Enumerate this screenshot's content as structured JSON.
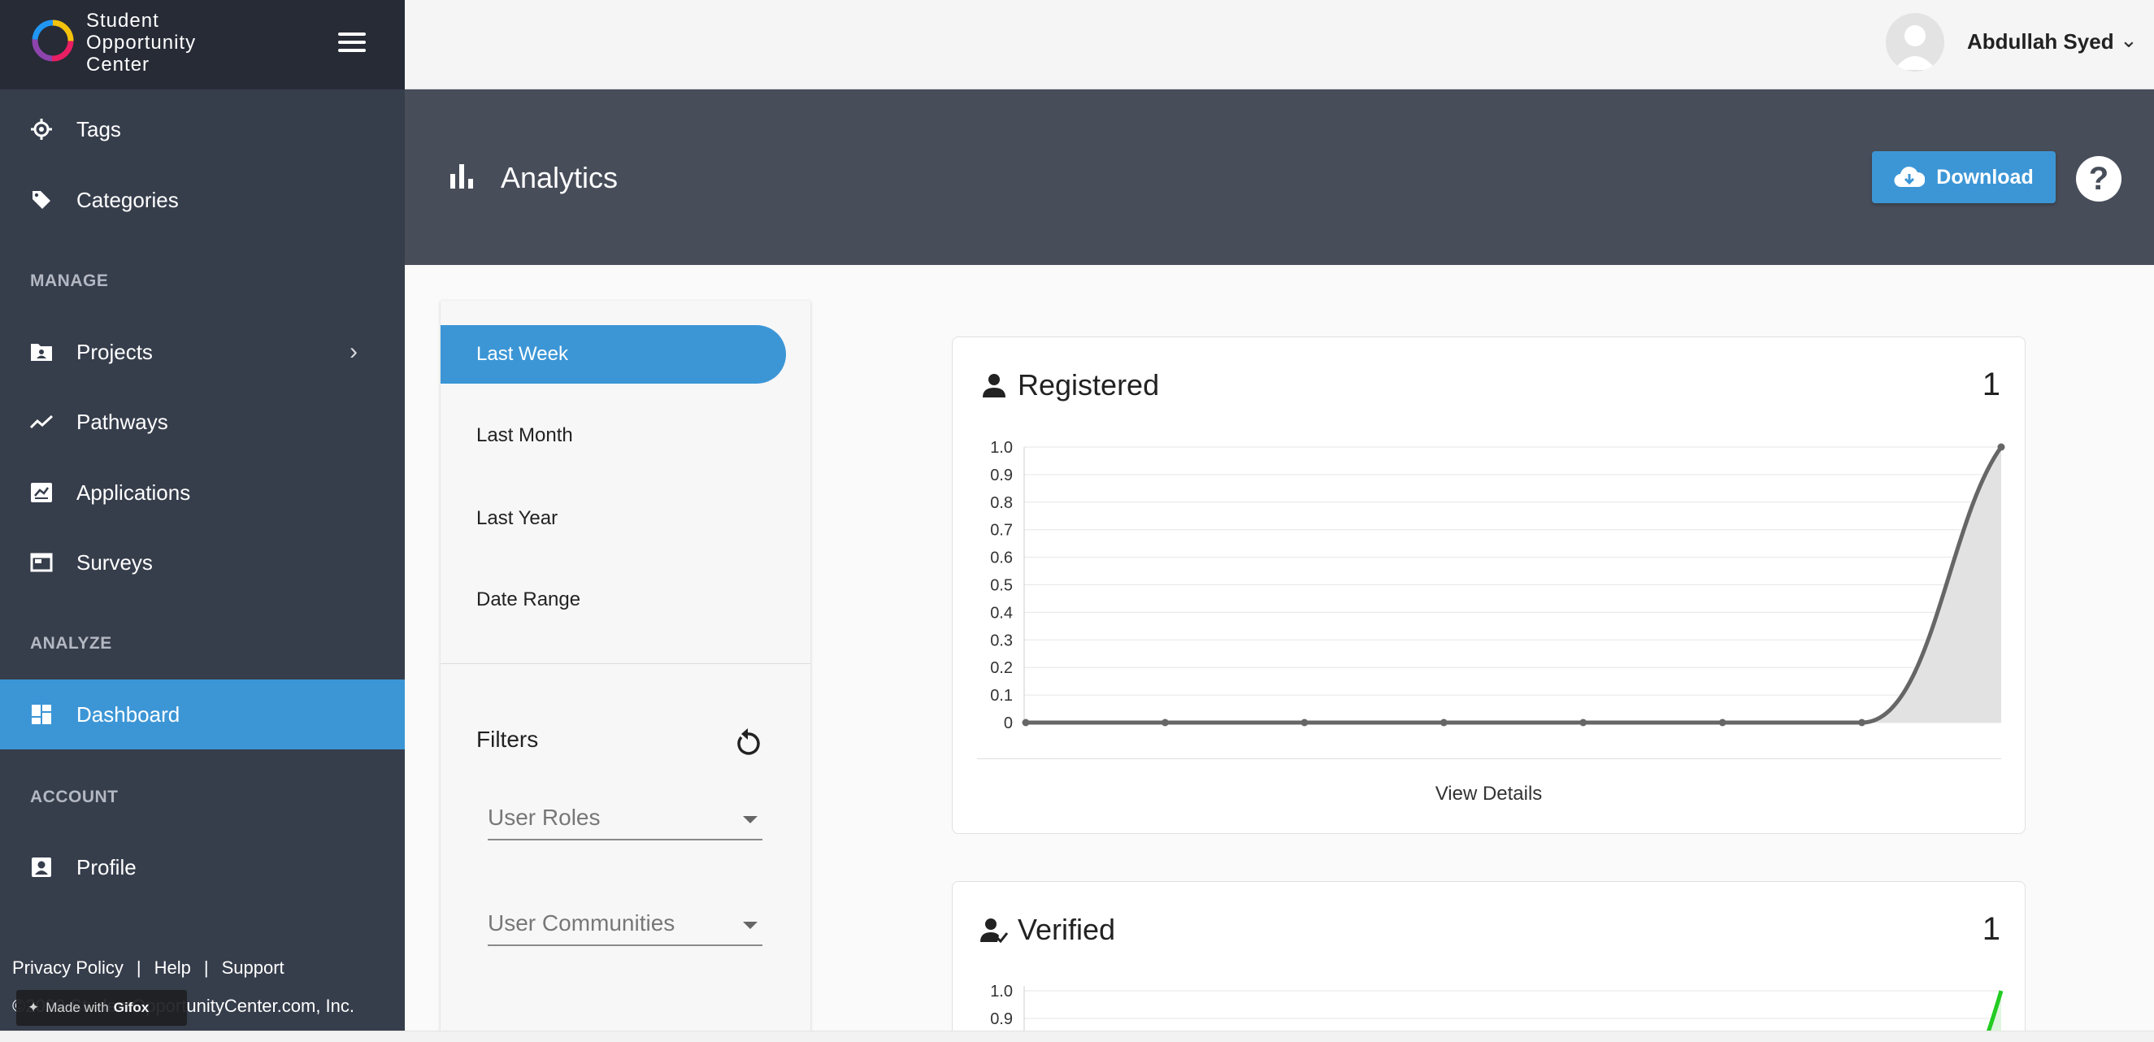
{
  "brand": {
    "name_line1": "Student",
    "name_line2": "Opportunity",
    "name_line3": "Center"
  },
  "sidebar": {
    "top_items": [
      {
        "label": "Tags",
        "icon": "target-icon"
      },
      {
        "label": "Categories",
        "icon": "tag-icon"
      }
    ],
    "sections": {
      "manage": "MANAGE",
      "analyze": "ANALYZE",
      "account": "ACCOUNT"
    },
    "manage_items": [
      {
        "label": "Projects",
        "icon": "folder-user-icon",
        "has_submenu": true
      },
      {
        "label": "Pathways",
        "icon": "trend-icon"
      },
      {
        "label": "Applications",
        "icon": "application-icon"
      },
      {
        "label": "Surveys",
        "icon": "survey-icon"
      }
    ],
    "analyze_items": [
      {
        "label": "Dashboard",
        "icon": "dashboard-icon",
        "active": true
      }
    ],
    "account_items": [
      {
        "label": "Profile",
        "icon": "profile-icon"
      }
    ],
    "footer": {
      "privacy": "Privacy Policy",
      "help": "Help",
      "support": "Support",
      "separator": "|",
      "copyright": "©2020 StudentOpportunityCenter.com, Inc.",
      "made_with_prefix": "Made with",
      "made_with_brand": "Gifox"
    }
  },
  "topbar": {
    "user_name": "Abdullah Syed"
  },
  "header": {
    "title": "Analytics",
    "download_label": "Download",
    "help_symbol": "?"
  },
  "panel": {
    "ranges": [
      "Last Week",
      "Last Month",
      "Last Year",
      "Date Range"
    ],
    "active_range": 0,
    "filters_title": "Filters",
    "selects": [
      "User Roles",
      "User Communities"
    ]
  },
  "cards": [
    {
      "title": "Registered",
      "count": "1",
      "details_label": "View Details"
    },
    {
      "title": "Verified",
      "count": "1"
    }
  ],
  "colors": {
    "accent": "#3c96d6",
    "sidebar_bg": "#363d4b",
    "header_bg": "#484d5a",
    "registered_line": "#666666",
    "verified_line": "#22cc22"
  },
  "chart_data": [
    {
      "type": "area",
      "title": "Registered",
      "x": [
        1,
        2,
        3,
        4,
        5,
        6,
        7,
        8
      ],
      "values": [
        0,
        0,
        0,
        0,
        0,
        0,
        0,
        1
      ],
      "y_ticks": [
        "0",
        "0.1",
        "0.2",
        "0.3",
        "0.4",
        "0.5",
        "0.6",
        "0.7",
        "0.8",
        "0.9",
        "1.0"
      ],
      "ylim": [
        0,
        1
      ],
      "grid": true
    },
    {
      "type": "area",
      "title": "Verified",
      "y_ticks": [
        "0.9",
        "1.0"
      ],
      "ylim": [
        0,
        1
      ],
      "grid": true
    }
  ]
}
